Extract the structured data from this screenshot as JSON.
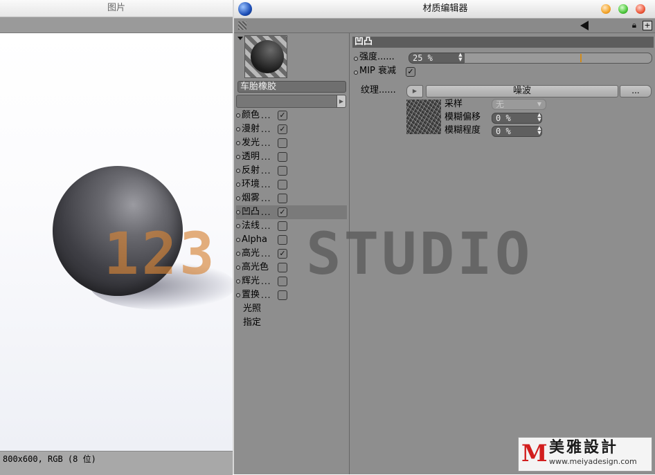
{
  "picture_window": {
    "title": "图片",
    "status": "800x600, RGB (8 位)"
  },
  "material_editor": {
    "title": "材质编辑器",
    "material_name": "车胎橡胶",
    "channels": [
      {
        "label": "颜色",
        "dots": "...",
        "checked": true
      },
      {
        "label": "漫射",
        "dots": "...",
        "checked": true
      },
      {
        "label": "发光",
        "dots": "...",
        "checked": false
      },
      {
        "label": "透明",
        "dots": "...",
        "checked": false
      },
      {
        "label": "反射",
        "dots": "...",
        "checked": false
      },
      {
        "label": "环境",
        "dots": "...",
        "checked": false
      },
      {
        "label": "烟雾",
        "dots": "...",
        "checked": false
      },
      {
        "label": "凹凸",
        "dots": "...",
        "checked": true,
        "selected": true
      },
      {
        "label": "法线",
        "dots": "...",
        "checked": false
      },
      {
        "label": "Alpha",
        "dots": "",
        "checked": false
      },
      {
        "label": "高光",
        "dots": "...",
        "checked": true
      },
      {
        "label": "高光色",
        "dots": "",
        "checked": false
      },
      {
        "label": "辉光",
        "dots": "...",
        "checked": false
      },
      {
        "label": "置换",
        "dots": "...",
        "checked": false
      }
    ],
    "extra_items": [
      "光照",
      "指定"
    ],
    "bump": {
      "section_title": "凹凸",
      "strength_label": "强度......",
      "strength_value": "25 %",
      "strength_fraction": 0.62,
      "mip_label": "MIP 衰减",
      "mip_checked": true,
      "texture_label": "纹理......",
      "texture_name": "噪波",
      "texture_more": "...",
      "sampling_label": "采样",
      "sampling_value": "无",
      "blur_offset_label": "模糊偏移",
      "blur_offset_value": "0 %",
      "blur_scale_label": "模糊程度",
      "blur_scale_value": "0 %"
    }
  },
  "watermark": {
    "number": "123",
    "studio": "STUDIO",
    "logo_mark": "M",
    "logo_cn": "美雅設計",
    "logo_url": "www.meiyadesign.com"
  },
  "colors": {
    "panel": "#8e8e8e",
    "slider_tick": "#d08a1a",
    "watermark_orange": "#d68438"
  },
  "icons": [
    "app-logo-icon",
    "back-arrow-icon",
    "lock-icon",
    "new-window-icon",
    "grip-icon"
  ]
}
